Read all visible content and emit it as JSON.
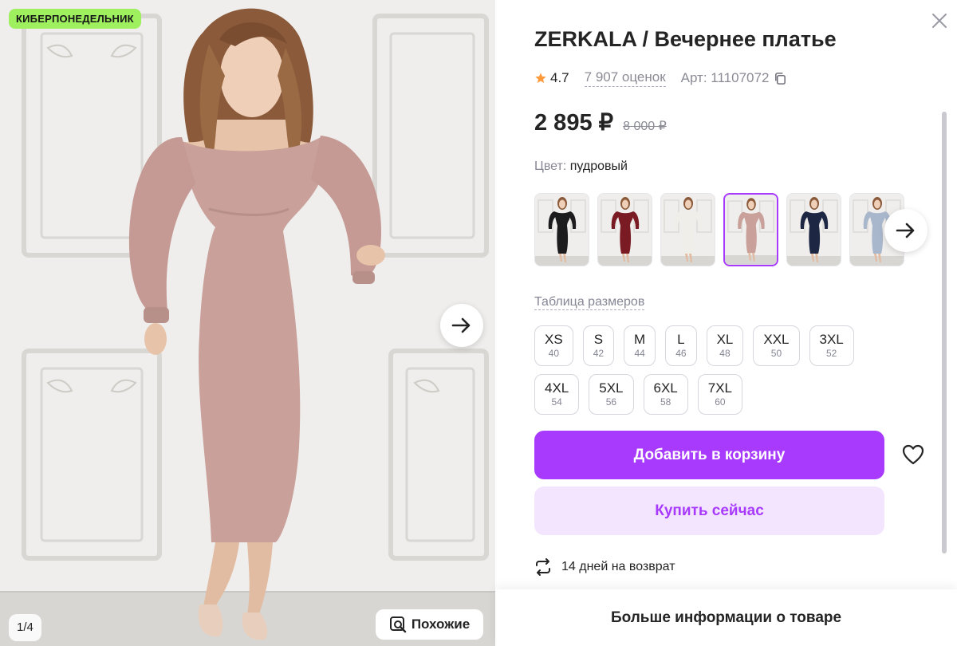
{
  "photo": {
    "badge": "КИБЕРПОНЕДЕЛЬНИК",
    "counter": "1/4",
    "similar_label": "Похожие",
    "dress_color": "#c9a09a"
  },
  "product": {
    "title": "ZERKALA / Вечернее платье",
    "rating": "4.7",
    "reviews": "7 907 оценок",
    "article": "Арт: 11107072",
    "price": "2 895 ₽",
    "old_price": "8 000 ₽",
    "color_label": "Цвет:",
    "color_value": "пудровый"
  },
  "swatches": [
    {
      "name": "black",
      "color": "#1c1c1e",
      "selected": false
    },
    {
      "name": "burgundy",
      "color": "#7a1a22",
      "selected": false
    },
    {
      "name": "white",
      "color": "#f0eee9",
      "selected": false
    },
    {
      "name": "powder",
      "color": "#c9a09a",
      "selected": true
    },
    {
      "name": "navy",
      "color": "#1d2744",
      "selected": false
    },
    {
      "name": "light-blue",
      "color": "#a9b7cc",
      "selected": false
    }
  ],
  "size_table_label": "Таблица размеров",
  "sizes": [
    {
      "name": "XS",
      "num": "40"
    },
    {
      "name": "S",
      "num": "42"
    },
    {
      "name": "M",
      "num": "44"
    },
    {
      "name": "L",
      "num": "46"
    },
    {
      "name": "XL",
      "num": "48"
    },
    {
      "name": "XXL",
      "num": "50"
    },
    {
      "name": "3XL",
      "num": "52"
    },
    {
      "name": "4XL",
      "num": "54"
    },
    {
      "name": "5XL",
      "num": "56"
    },
    {
      "name": "6XL",
      "num": "58"
    },
    {
      "name": "7XL",
      "num": "60"
    }
  ],
  "actions": {
    "add_to_cart": "Добавить в корзину",
    "buy_now": "Купить сейчас",
    "returns": "14 дней на возврат",
    "more_info": "Больше информации о товаре"
  },
  "colors": {
    "accent": "#a73afd",
    "accent_light": "#f3e5fe",
    "badge": "#9ef05f",
    "star": "#ff9a3c"
  }
}
